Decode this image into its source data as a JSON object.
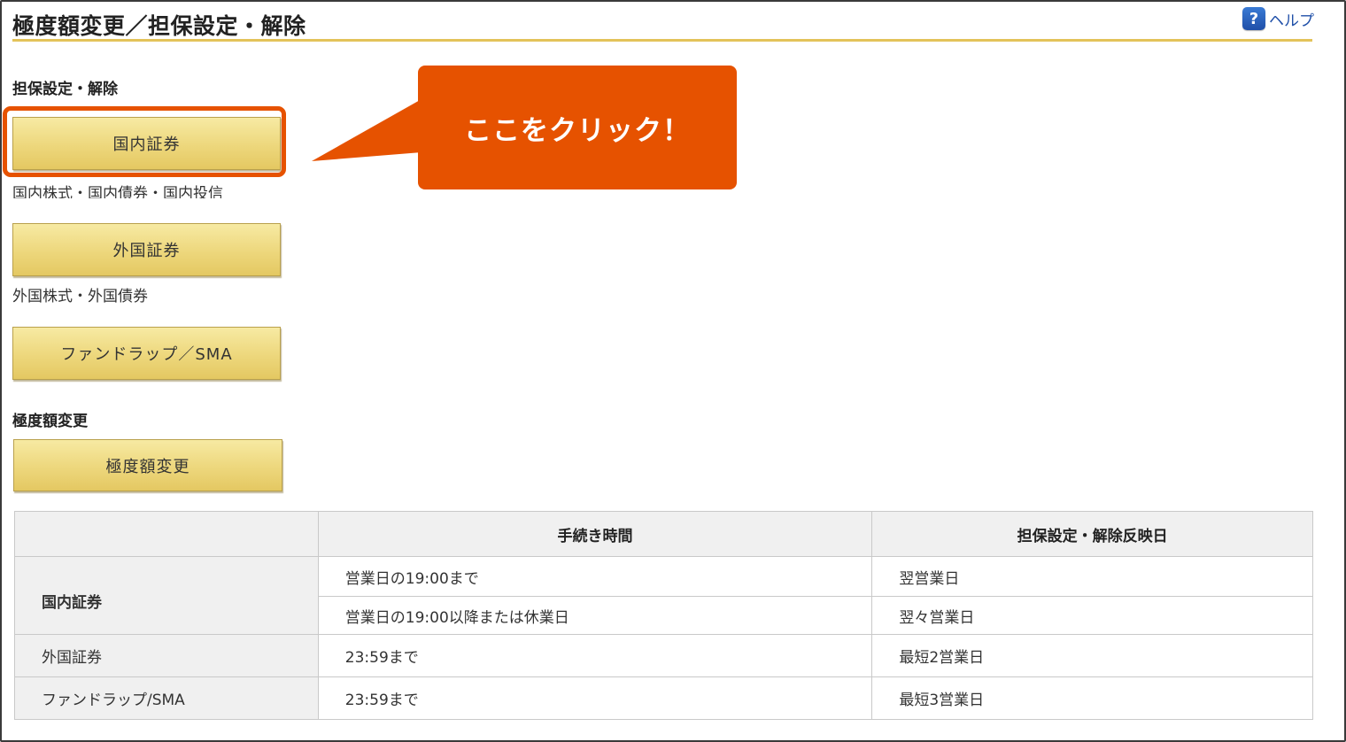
{
  "header": {
    "title": "極度額変更／担保設定・解除",
    "help_label": "ヘルプ",
    "help_icon_glyph": "?"
  },
  "collateral_section": {
    "heading": "担保設定・解除",
    "buttons": [
      {
        "label": "国内証券",
        "description": "国内株式・国内債券・国内投信"
      },
      {
        "label": "外国証券",
        "description": "外国株式・外国債券"
      },
      {
        "label": "ファンドラップ／SMA",
        "description": ""
      }
    ]
  },
  "limit_section": {
    "heading": "極度額変更",
    "button_label": "極度額変更"
  },
  "callout": {
    "text": "ここをクリック！",
    "color": "#e65200"
  },
  "table": {
    "headers": [
      "",
      "手続き時間",
      "担保設定・解除反映日"
    ],
    "rows": [
      {
        "category": "国内証券",
        "time": "営業日の19:00まで",
        "date": "翌営業日"
      },
      {
        "category": "",
        "time": "営業日の19:00以降または休業日",
        "date": "翌々営業日"
      },
      {
        "category": "外国証券",
        "time": "23:59まで",
        "date": "最短2営業日"
      },
      {
        "category": "ファンドラップ/SMA",
        "time": "23:59まで",
        "date": "最短3営業日"
      }
    ]
  },
  "colors": {
    "accent_rule": "#e3c35a",
    "button_gold": "#edd77c",
    "highlight": "#e65200"
  }
}
